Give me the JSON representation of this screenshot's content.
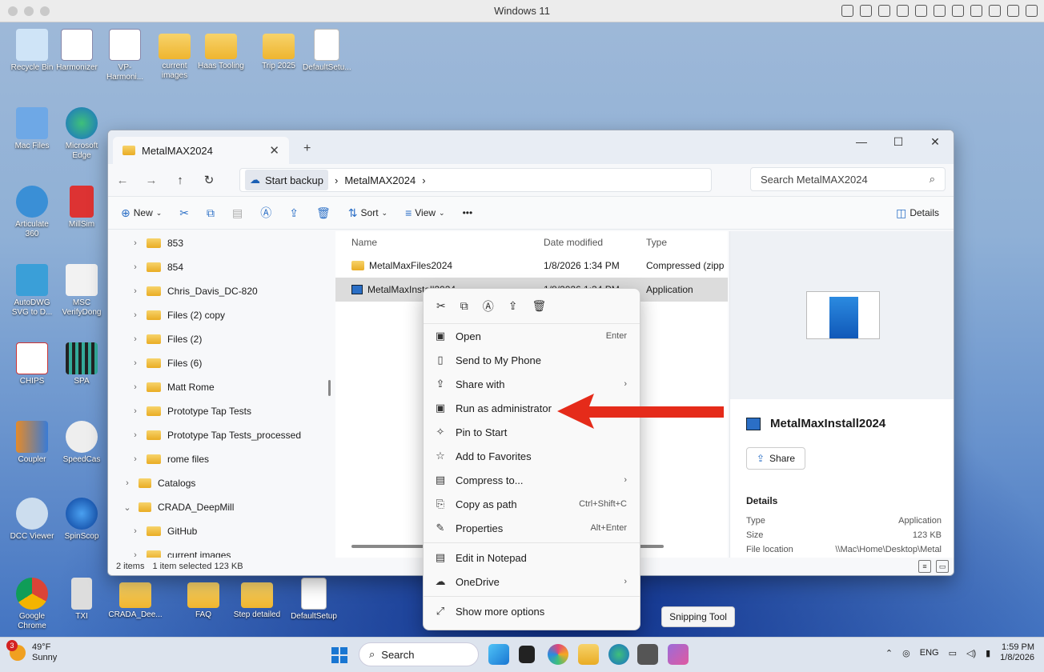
{
  "mac": {
    "title": "Windows 11"
  },
  "desktop": {
    "icons": [
      {
        "label": "Recycle Bin"
      },
      {
        "label": "Harmonizer"
      },
      {
        "label": "VP-Harmoni..."
      },
      {
        "label": "current images"
      },
      {
        "label": "Haas Tooling"
      },
      {
        "label": "Trip 2025"
      },
      {
        "label": "DefaultSetu..."
      },
      {
        "label": "Mac Files"
      },
      {
        "label": "Microsoft Edge"
      },
      {
        "label": "Articulate 360"
      },
      {
        "label": "MillSim"
      },
      {
        "label": "AutoDWG SVG to D..."
      },
      {
        "label": "MSC VerifyDong"
      },
      {
        "label": "CHIPS"
      },
      {
        "label": "SPA"
      },
      {
        "label": "Coupler"
      },
      {
        "label": "SpeedCas"
      },
      {
        "label": "DCC Viewer"
      },
      {
        "label": "SpinScop"
      },
      {
        "label": "Google Chrome"
      },
      {
        "label": "TXI"
      },
      {
        "label": "CRADA_Dee..."
      },
      {
        "label": "FAQ"
      },
      {
        "label": "Step detailed"
      },
      {
        "label": "DefaultSetup"
      }
    ]
  },
  "explorer": {
    "tab_title": "MetalMAX2024",
    "address": {
      "root": "Start backup",
      "folder": "MetalMAX2024"
    },
    "search_placeholder": "Search MetalMAX2024",
    "toolbar": {
      "new": "New",
      "sort": "Sort",
      "view": "View",
      "more": "•••",
      "details": "Details"
    },
    "nav_items": [
      {
        "label": "853",
        "indent": 1
      },
      {
        "label": "854",
        "indent": 1
      },
      {
        "label": "Chris_Davis_DC-820",
        "indent": 1
      },
      {
        "label": "Files (2) copy",
        "indent": 1
      },
      {
        "label": "Files (2)",
        "indent": 1
      },
      {
        "label": "Files (6)",
        "indent": 1
      },
      {
        "label": "Matt Rome",
        "indent": 1
      },
      {
        "label": "Prototype Tap Tests",
        "indent": 1
      },
      {
        "label": "Prototype Tap Tests_processed",
        "indent": 1
      },
      {
        "label": "rome files",
        "indent": 1
      },
      {
        "label": "Catalogs",
        "indent": 0
      },
      {
        "label": "CRADA_DeepMill",
        "indent": 0
      },
      {
        "label": "GitHub",
        "indent": 1
      },
      {
        "label": "current images",
        "indent": 1
      }
    ],
    "columns": {
      "name": "Name",
      "date": "Date modified",
      "type": "Type"
    },
    "files": [
      {
        "name": "MetalMaxFiles2024",
        "date": "1/8/2026 1:34 PM",
        "type": "Compressed (zipp"
      },
      {
        "name": "MetalMaxInstall2024",
        "date": "1/8/2026 1:34 PM",
        "type": "Application"
      }
    ],
    "preview": {
      "name": "MetalMaxInstall2024",
      "share": "Share",
      "details_heading": "Details",
      "type_label": "Type",
      "type_value": "Application",
      "size_label": "Size",
      "size_value": "123 KB",
      "location_label": "File location",
      "location_value": "\\\\Mac\\Home\\Desktop\\Metal"
    },
    "status": {
      "items": "2 items",
      "selected": "1 item selected  123 KB"
    }
  },
  "context_menu": {
    "items": [
      {
        "label": "Open",
        "shortcut": "Enter"
      },
      {
        "label": "Send to My Phone",
        "shortcut": ""
      },
      {
        "label": "Share with",
        "shortcut": ""
      },
      {
        "label": "Run as administrator",
        "shortcut": ""
      },
      {
        "label": "Pin to Start",
        "shortcut": ""
      },
      {
        "label": "Add to Favorites",
        "shortcut": ""
      },
      {
        "label": "Compress to...",
        "shortcut": ""
      },
      {
        "label": "Copy as path",
        "shortcut": "Ctrl+Shift+C"
      },
      {
        "label": "Properties",
        "shortcut": "Alt+Enter"
      },
      {
        "label": "Edit in Notepad",
        "shortcut": ""
      },
      {
        "label": "OneDrive",
        "shortcut": ""
      },
      {
        "label": "Show more options",
        "shortcut": ""
      }
    ]
  },
  "tooltip": "Snipping Tool",
  "taskbar": {
    "weather_badge": "3",
    "temp": "49°F",
    "condition": "Sunny",
    "search": "Search",
    "lang": "ENG",
    "time": "1:59 PM",
    "date": "1/8/2026"
  },
  "colors": {
    "accent": "#1976d2",
    "arrow": "#e52b1a"
  }
}
